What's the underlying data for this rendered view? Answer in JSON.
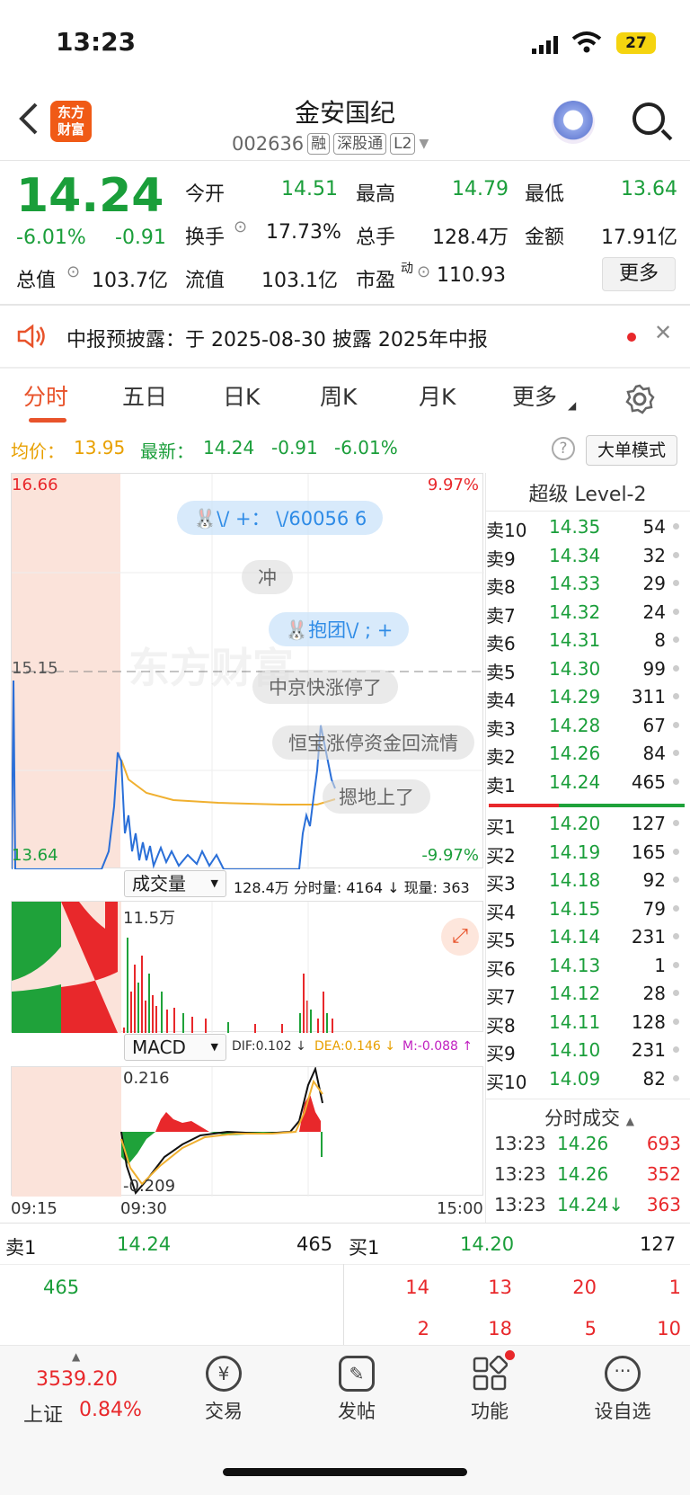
{
  "status": {
    "time": "13:23",
    "battery": "27"
  },
  "header": {
    "logo": "东方\n财富",
    "title": "金安国纪",
    "code": "002636",
    "tags": [
      "融",
      "深股通",
      "L2"
    ]
  },
  "quote": {
    "price": "14.24",
    "pct": "-6.01%",
    "chg": "-0.91",
    "jk_l": "今开",
    "jk": "14.51",
    "zg_l": "最高",
    "zg": "14.79",
    "zd_l": "最低",
    "zd": "13.64",
    "hs_l": "换手",
    "hs": "17.73%",
    "zs_l": "总手",
    "zs": "128.4万",
    "je_l": "金额",
    "je": "17.91亿",
    "zz_l": "总值",
    "zz": "103.7亿",
    "lz_l": "流值",
    "lz": "103.1亿",
    "sy_l": "市盈",
    "sy_sup": "动",
    "sy": "110.93",
    "more": "更多"
  },
  "notice": {
    "text": "中报预披露：于 2025-08-30 披露 2025年中报"
  },
  "tabs": [
    "分时",
    "五日",
    "日K",
    "周K",
    "月K",
    "更多"
  ],
  "info": {
    "avg_l": "均价：",
    "avg": "13.95",
    "new_l": "最新：",
    "new": "14.24",
    "chg": "-0.91",
    "pct": "-6.01%",
    "mode": "大单模式"
  },
  "chart": {
    "top": "16.66",
    "top_pct": "9.97%",
    "mid": "15.15",
    "bot": "13.64",
    "bot_pct": "-9.97%",
    "bubbles": [
      "\\/ +：   \\/60056 6",
      "冲",
      "抱团\\/ ; +",
      "中京快涨停了",
      "恒宝涨停资金回流情",
      "摁地上了"
    ],
    "vol_sel": "成交量",
    "vol_info": "128.4万 分时量: 4164 ↓ 现量: 363",
    "vol_max": "11.5万",
    "macd_sel": "MACD",
    "dif": "DIF:0.102 ↓",
    "dea": "DEA:0.146 ↓",
    "m": "M:-0.088 ↑",
    "macd_top": "0.216",
    "macd_bot": "-0.209",
    "t0": "09:15",
    "t1": "09:30",
    "t2": "15:00"
  },
  "orderbook": {
    "title": "超级 Level-2",
    "sells": [
      [
        "卖10",
        "14.35",
        "54"
      ],
      [
        "卖9",
        "14.34",
        "32"
      ],
      [
        "卖8",
        "14.33",
        "29"
      ],
      [
        "卖7",
        "14.32",
        "24"
      ],
      [
        "卖6",
        "14.31",
        "8"
      ],
      [
        "卖5",
        "14.30",
        "99"
      ],
      [
        "卖4",
        "14.29",
        "311"
      ],
      [
        "卖3",
        "14.28",
        "67"
      ],
      [
        "卖2",
        "14.26",
        "84"
      ],
      [
        "卖1",
        "14.24",
        "465"
      ]
    ],
    "buys": [
      [
        "买1",
        "14.20",
        "127"
      ],
      [
        "买2",
        "14.19",
        "165"
      ],
      [
        "买3",
        "14.18",
        "92"
      ],
      [
        "买4",
        "14.15",
        "79"
      ],
      [
        "买5",
        "14.14",
        "231"
      ],
      [
        "买6",
        "14.13",
        "1"
      ],
      [
        "买7",
        "14.12",
        "28"
      ],
      [
        "买8",
        "14.11",
        "128"
      ],
      [
        "买9",
        "14.10",
        "231"
      ],
      [
        "买10",
        "14.09",
        "82"
      ]
    ],
    "ticks_title": "分时成交",
    "ticks": [
      [
        "13:23",
        "14.26",
        "693"
      ],
      [
        "13:23",
        "14.26",
        "352"
      ],
      [
        "13:23",
        "14.24↓",
        "363"
      ]
    ]
  },
  "queue": {
    "s_l": "卖1",
    "s_p": "14.24",
    "s_v": "465",
    "b_l": "买1",
    "b_p": "14.20",
    "b_v": "127",
    "s_items": [
      "465"
    ],
    "b_row1": [
      "14",
      "13",
      "20",
      "1"
    ],
    "b_row2": [
      "2",
      "18",
      "5",
      "10"
    ]
  },
  "bottom": {
    "index_val": "3539.20",
    "index_name": "上证",
    "index_pct": "0.84%",
    "items": [
      "交易",
      "发帖",
      "功能",
      "设自选"
    ]
  }
}
